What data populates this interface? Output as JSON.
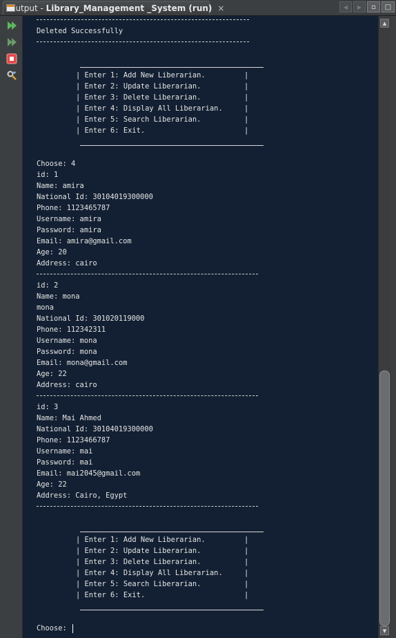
{
  "window": {
    "tab_prefix": "Output - ",
    "tab_name": "Library_Management _System (run)",
    "close_glyph": "×",
    "nav_prev_glyph": "◀",
    "nav_next_glyph": "▶",
    "restore_glyph": "▫",
    "maximize_glyph": "□"
  },
  "toolbar": {
    "icons": [
      "rerun-icon",
      "rerun-with-options-icon",
      "stop-icon",
      "settings-icon"
    ]
  },
  "console": {
    "deleted_msg": "Deleted Successfully",
    "menu": [
      "| Enter 1: Add New Liberarian.         |",
      "| Enter 2: Update Liberarian.          |",
      "| Enter 3: Delete Liberarian.          |",
      "| Enter 4: Display All Liberarian.     |",
      "| Enter 5: Search Liberarian.          |",
      "| Enter 6: Exit.                       |"
    ],
    "choose_input": "Choose: 4",
    "records": [
      {
        "lines": [
          "id: 1",
          "Name: amira",
          "National Id: 30104019300000",
          "Phone: 1123465787",
          "Username: amira",
          "Password: amira",
          "Email: amira@gmail.com",
          "Age: 20",
          "Address: cairo"
        ]
      },
      {
        "lines": [
          "id: 2",
          "Name: mona",
          "mona",
          "National Id: 301020119000",
          "Phone: 112342311",
          "Username: mona",
          "Password: mona",
          "Email: mona@gmail.com",
          "Age: 22",
          "Address: cairo"
        ]
      },
      {
        "lines": [
          "id: 3",
          "Name: Mai Ahmed",
          "National Id: 30104019300000",
          "Phone: 1123466787",
          "Username: mai",
          "Password: mai",
          "Email: mai2045@gmail.com",
          "Age: 22",
          "Address: Cairo, Egypt"
        ]
      }
    ],
    "choose_prompt": "Choose: "
  },
  "scrollbar": {
    "up_glyph": "▲",
    "down_glyph": "▼"
  }
}
